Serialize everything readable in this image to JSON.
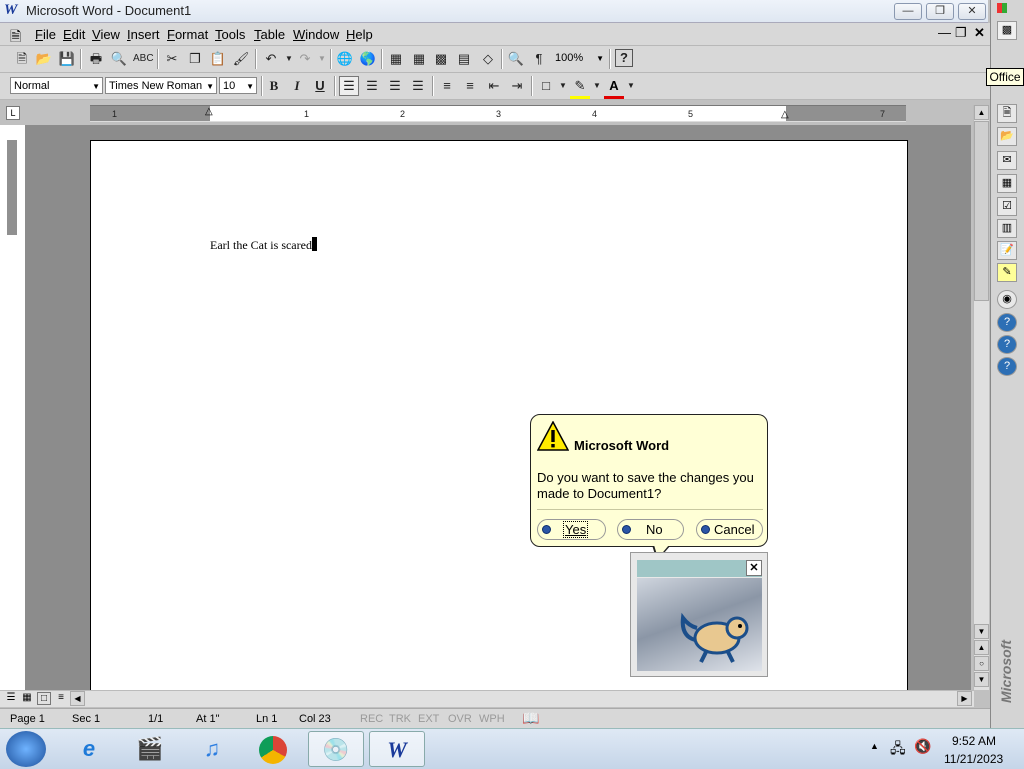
{
  "window": {
    "title": "Microsoft Word - Document1"
  },
  "menu": [
    "File",
    "Edit",
    "View",
    "Insert",
    "Format",
    "Tools",
    "Table",
    "Window",
    "Help"
  ],
  "standard_toolbar": {
    "zoom": "100%"
  },
  "formatting_toolbar": {
    "style": "Normal",
    "font": "Times New Roman",
    "size": "10",
    "bold": "B",
    "italic": "I",
    "underline": "U"
  },
  "ruler": {
    "numbers": [
      "1",
      "1",
      "2",
      "3",
      "4",
      "5",
      "7"
    ]
  },
  "document": {
    "text": "Earl the Cat is scared"
  },
  "dialog": {
    "title": "Microsoft Word",
    "message": "Do you want to save the changes you made to Document1?",
    "buttons": {
      "yes": "Yes",
      "no": "No",
      "cancel": "Cancel"
    }
  },
  "status": {
    "page": "Page 1",
    "sec": "Sec 1",
    "pages": "1/1",
    "at": "At 1\"",
    "ln": "Ln 1",
    "col": "Col 23",
    "rec": "REC",
    "trk": "TRK",
    "ext": "EXT",
    "ovr": "OVR",
    "wph": "WPH"
  },
  "office_bar": {
    "tooltip": "Office",
    "brand": "Microsoft"
  },
  "taskbar": {
    "time": "9:52 AM",
    "date": "11/21/2023"
  }
}
